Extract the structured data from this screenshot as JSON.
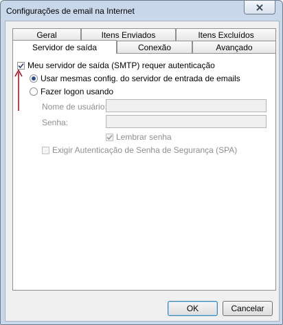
{
  "window": {
    "title": "Configurações de email na Internet"
  },
  "tabs": {
    "row1": [
      "Geral",
      "Itens Enviados",
      "Itens Excluídos"
    ],
    "row2": [
      "Servidor de saída",
      "Conexão",
      "Avançado"
    ]
  },
  "panel": {
    "smtp_auth_label": "Meu servidor de saída (SMTP) requer autenticação",
    "smtp_auth_checked": true,
    "same_settings_label": "Usar mesmas config. do servidor de entrada de emails",
    "logon_label": "Fazer logon usando",
    "selected_option": "same_settings",
    "username_label": "Nome de usuário:",
    "username_value": "",
    "password_label": "Senha:",
    "password_value": "",
    "remember_label": "Lembrar senha",
    "remember_checked": true,
    "spa_label": "Exigir Autenticação de Senha de Segurança (SPA)",
    "spa_checked": false
  },
  "buttons": {
    "ok": "OK",
    "cancel": "Cancelar"
  },
  "colors": {
    "annotation_arrow": "#b01020",
    "radio_selected": "#2a4f91"
  }
}
